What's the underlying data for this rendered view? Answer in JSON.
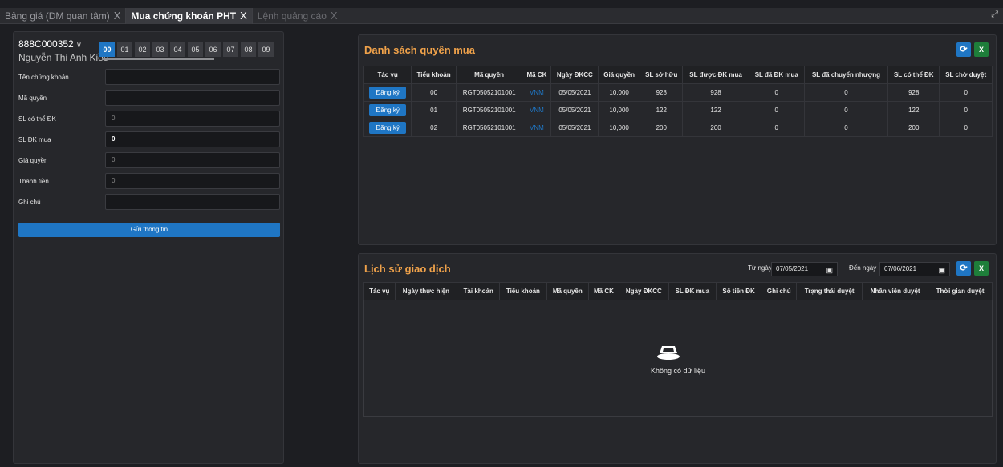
{
  "tabs": [
    {
      "label": "Bảng giá (DM quan tâm)",
      "close": "X"
    },
    {
      "label": "Mua chứng khoán PHT",
      "close": "X"
    },
    {
      "label": "Lệnh quảng cáo",
      "close": "X"
    }
  ],
  "account": {
    "id": "888C000352",
    "chevron": "∨",
    "name": "Nguyễn Thị Anh Kiều"
  },
  "subaccounts": [
    "00",
    "01",
    "02",
    "03",
    "04",
    "05",
    "06",
    "07",
    "08",
    "09"
  ],
  "form": {
    "fields": [
      {
        "label": "Tên chứng khoán",
        "value": ""
      },
      {
        "label": "Mã quyền",
        "value": ""
      },
      {
        "label": "SL có thể ĐK",
        "value": "0"
      },
      {
        "label": "SL ĐK mua",
        "value": "0"
      },
      {
        "label": "Giá quyền",
        "value": "0"
      },
      {
        "label": "Thành tiền",
        "value": "0"
      },
      {
        "label": "Ghi chú",
        "value": ""
      }
    ],
    "submit_label": "Gửi thông tin"
  },
  "rights": {
    "title": "Danh sách quyền mua",
    "excel_label": "X",
    "columns": [
      "Tác vụ",
      "Tiểu khoản",
      "Mã quyền",
      "Mã CK",
      "Ngày ĐKCC",
      "Giá quyền",
      "SL sở hữu",
      "SL được ĐK mua",
      "SL đã ĐK mua",
      "SL đã chuyển nhượng",
      "SL có thể ĐK",
      "SL chờ duyệt"
    ],
    "rows": [
      {
        "action": "Đăng ký",
        "subacc": "00",
        "code": "RGT05052101001",
        "symbol": "VNM",
        "date": "05/05/2021",
        "price": "10,000",
        "owned": "928",
        "eligible": "928",
        "registered": "0",
        "transferred": "0",
        "available": "928",
        "pending": "0"
      },
      {
        "action": "Đăng ký",
        "subacc": "01",
        "code": "RGT05052101001",
        "symbol": "VNM",
        "date": "05/05/2021",
        "price": "10,000",
        "owned": "122",
        "eligible": "122",
        "registered": "0",
        "transferred": "0",
        "available": "122",
        "pending": "0"
      },
      {
        "action": "Đăng ký",
        "subacc": "02",
        "code": "RGT05052101001",
        "symbol": "VNM",
        "date": "05/05/2021",
        "price": "10,000",
        "owned": "200",
        "eligible": "200",
        "registered": "0",
        "transferred": "0",
        "available": "200",
        "pending": "0"
      }
    ]
  },
  "history": {
    "title": "Lịch sử giao dịch",
    "from_label": "Từ ngày",
    "from_date": "07/05/2021",
    "to_label": "Đến ngày",
    "to_date": "07/06/2021",
    "excel_label": "X",
    "columns": [
      "Tác vụ",
      "Ngày thực hiện",
      "Tài khoản",
      "Tiểu khoản",
      "Mã quyền",
      "Mã CK",
      "Ngày ĐKCC",
      "SL ĐK mua",
      "Số tiền ĐK",
      "Ghi chú",
      "Trạng thái duyệt",
      "Nhân viên duyệt",
      "Thời gian duyệt"
    ],
    "empty_text": "Không có dữ liệu"
  },
  "colors": {
    "accent": "#1f76c4",
    "title": "#f0a24a",
    "excel": "#1e7e3a",
    "bg": "#1d1e22",
    "panel": "#26272b"
  }
}
